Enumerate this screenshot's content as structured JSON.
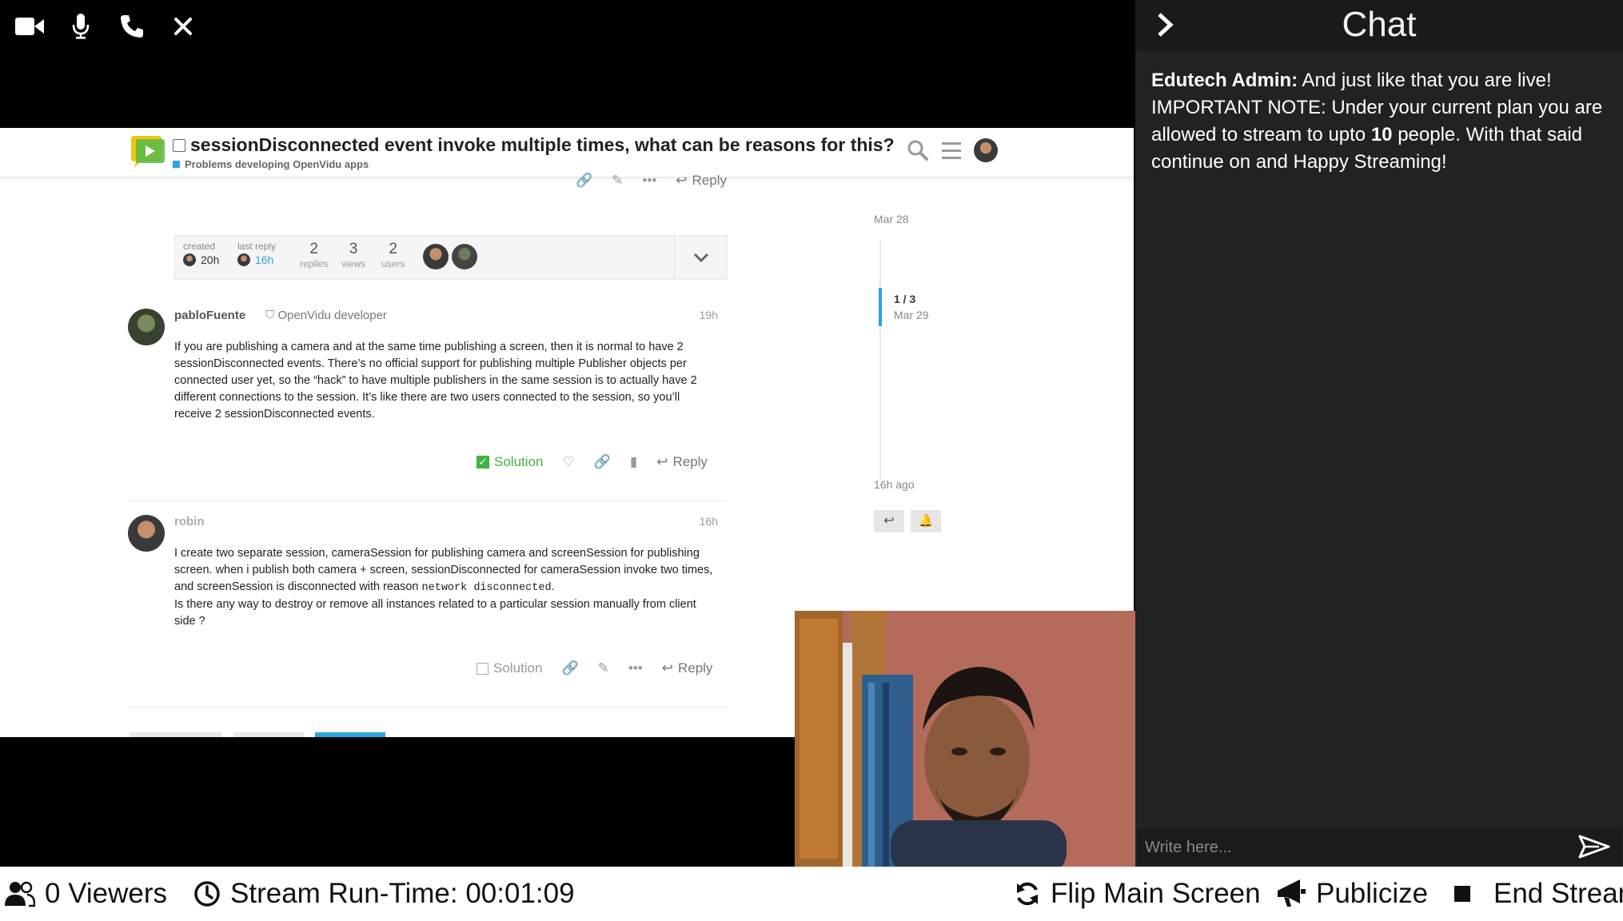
{
  "controls": {
    "video_icon": "video-camera",
    "mic_icon": "microphone",
    "phone_icon": "phone",
    "close_icon": "close-x"
  },
  "forum": {
    "topic_title": "sessionDisconnected event invoke multiple times, what can be reasons for this?",
    "category": "Problems developing OpenVidu apps",
    "top_actions": {
      "reply_label": "Reply"
    },
    "summary": {
      "created_label": "created",
      "created_value": "20h",
      "last_reply_label": "last reply",
      "last_reply_value": "16h",
      "replies_num": "2",
      "replies_label": "replies",
      "views_num": "3",
      "views_label": "views",
      "users_num": "2",
      "users_label": "users"
    },
    "posts": [
      {
        "username": "pabloFuente",
        "user_title": "OpenVidu developer",
        "time": "19h",
        "body": "If you are publishing a camera and at the same time publishing a screen, then it is normal to have 2 sessionDisconnected events. There’s no official support for publishing multiple Publisher objects per connected user yet, so the “hack” to have multiple publishers in the same session is to actually have 2 different connections to the session. It’s like there are two users connected to the session, so you’ll receive 2 sessionDisconnected events.",
        "solution_label": "Solution",
        "reply_label": "Reply"
      },
      {
        "username": "robin",
        "time": "16h",
        "body_part1": "I create two separate session, cameraSession for publishing camera and screenSession for publishing screen. when i publish both camera + screen, sessionDisconnected for cameraSession invoke two times, and screenSession is disconnected with reason ",
        "body_code": "network disconnected",
        "body_part2": ".",
        "body_line2": "Is there any way to destroy or remove all instances related to a particular session manually from client side ?",
        "solution_label": "Solution",
        "reply_label": "Reply"
      }
    ],
    "timeline": {
      "start_date": "Mar 28",
      "position": "1 / 3",
      "position_date": "Mar 29",
      "end_label": "16h ago"
    }
  },
  "chat": {
    "title": "Chat",
    "messages": [
      {
        "sender": "Edutech Admin:",
        "text_1": " And just like that you are live! IMPORTANT NOTE: Under your current plan you are allowed to stream to upto ",
        "highlight": "10",
        "text_2": " people. With that said continue on and Happy Streaming!"
      }
    ],
    "input_placeholder": "Write here..."
  },
  "bottombar": {
    "viewers": "0 Viewers",
    "runtime": "Stream Run-Time: 00:01:09",
    "flip": "Flip Main Screen",
    "publicize": "Publicize",
    "end": "End Stream"
  },
  "colors": {
    "chat_bg": "#222222",
    "solution_green": "#3eb541",
    "link_blue": "#2fa4e0"
  }
}
